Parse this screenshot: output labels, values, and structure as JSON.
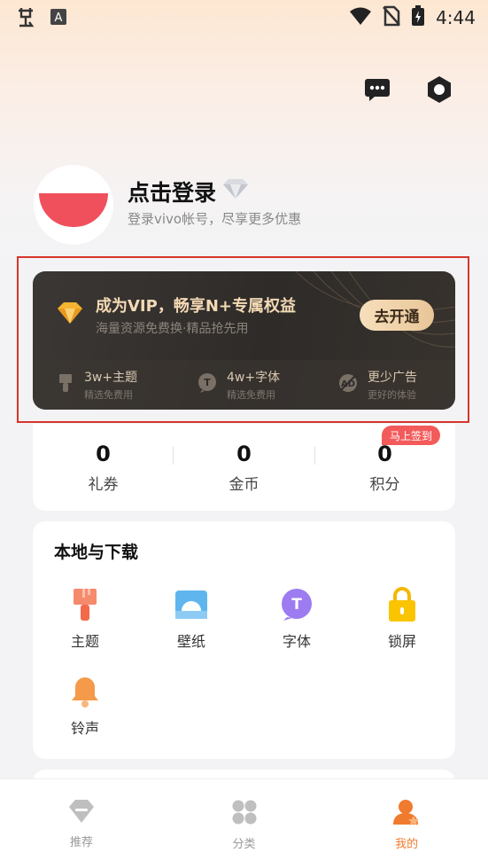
{
  "status_bar": {
    "time": "4:44",
    "left_icon_1": "app-logo-icon",
    "left_icon_2": "font-app-icon"
  },
  "header": {
    "message_icon": "message-icon",
    "settings_icon": "settings-hex-icon"
  },
  "profile": {
    "title": "点击登录",
    "subtitle": "登录vivo帐号，尽享更多优惠"
  },
  "vip": {
    "title": "成为VIP，畅享N+专属权益",
    "subtitle": "海量资源免费换·精品抢先用",
    "button": "去开通",
    "perks": [
      {
        "title": "3w+主题",
        "sub": "精选免费用",
        "icon": "brush-icon"
      },
      {
        "title": "4w+字体",
        "sub": "精选免费用",
        "icon": "font-bubble-icon"
      },
      {
        "title": "更少广告",
        "sub": "更好的体验",
        "icon": "no-ads-icon"
      }
    ]
  },
  "stats": {
    "items": [
      {
        "value": "0",
        "label": "礼券"
      },
      {
        "value": "0",
        "label": "金币"
      },
      {
        "value": "0",
        "label": "积分"
      }
    ],
    "sign_badge": "马上签到"
  },
  "local": {
    "title": "本地与下载",
    "items": [
      {
        "label": "主题",
        "icon": "brush-icon"
      },
      {
        "label": "壁纸",
        "icon": "wallpaper-icon"
      },
      {
        "label": "字体",
        "icon": "font-icon"
      },
      {
        "label": "锁屏",
        "icon": "lock-icon"
      },
      {
        "label": "铃声",
        "icon": "bell-icon"
      }
    ]
  },
  "tabbar": {
    "items": [
      {
        "label": "推荐",
        "icon": "recommend-icon"
      },
      {
        "label": "分类",
        "icon": "category-icon"
      },
      {
        "label": "我的",
        "icon": "profile-icon"
      }
    ]
  },
  "colors": {
    "accent": "#f07a2e",
    "vip_gold": "#f3d9b4",
    "badge_red": "#f35b5b"
  }
}
